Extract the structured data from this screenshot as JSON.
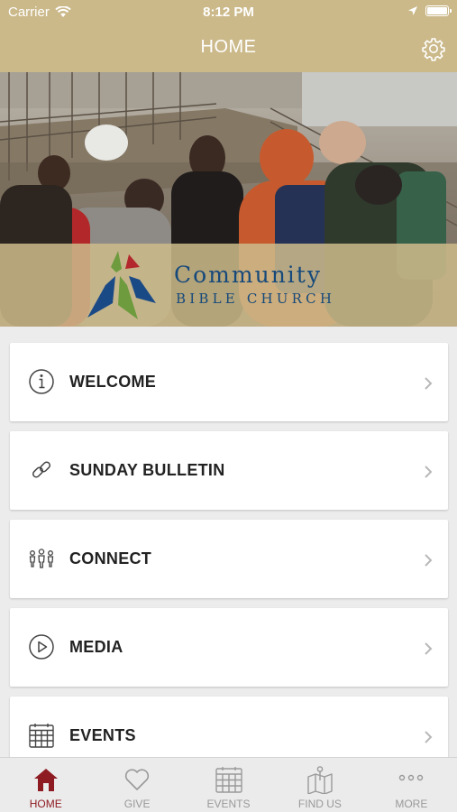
{
  "status_bar": {
    "carrier": "Carrier",
    "time": "8:12 PM"
  },
  "nav": {
    "title": "HOME"
  },
  "hero": {
    "logo_line1": "Community",
    "logo_line2": "BIBLE CHURCH"
  },
  "menu": [
    {
      "label": "WELCOME",
      "icon": "info-icon"
    },
    {
      "label": "SUNDAY BULLETIN",
      "icon": "link-icon"
    },
    {
      "label": "CONNECT",
      "icon": "people-icon"
    },
    {
      "label": "MEDIA",
      "icon": "play-icon"
    },
    {
      "label": "EVENTS",
      "icon": "calendar-icon"
    }
  ],
  "tabs": [
    {
      "label": "HOME",
      "icon": "home-icon",
      "active": true
    },
    {
      "label": "GIVE",
      "icon": "heart-icon"
    },
    {
      "label": "EVENTS",
      "icon": "calendar-icon"
    },
    {
      "label": "FIND US",
      "icon": "map-icon"
    },
    {
      "label": "MORE",
      "icon": "more-icon"
    }
  ],
  "colors": {
    "header": "#cbb98a",
    "active_tab": "#8e1b22",
    "logo_blue": "#16497b"
  }
}
